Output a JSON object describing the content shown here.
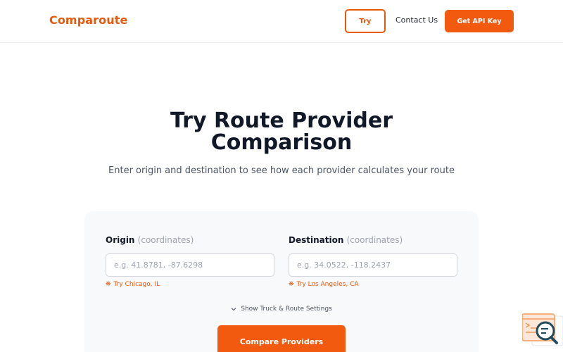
{
  "header": {
    "logo": "Comparoute",
    "try_label": "Try",
    "contact_label": "Contact Us",
    "api_label": "Get API Key"
  },
  "hero": {
    "title_line1": "Try Route Provider",
    "title_line2": "Comparison",
    "subtitle": "Enter origin and destination to see how each provider calculates your route"
  },
  "form": {
    "origin": {
      "label": "Origin",
      "hint": "(coordinates)",
      "placeholder": "e.g. 41.8781, -87.6298",
      "try_text": "Try Chicago, IL"
    },
    "destination": {
      "label": "Destination",
      "hint": "(coordinates)",
      "placeholder": "e.g. 34.0522, -118.2437",
      "try_text": "Try Los Angeles, CA"
    },
    "settings_toggle": "Show Truck & Route Settings",
    "submit_label": "Compare Providers"
  },
  "colors": {
    "accent": "#f25a0f",
    "card_bg": "#f8f9fa"
  },
  "icons": {
    "spark": "sparkle-icon",
    "chevron": "chevron-down-icon",
    "widget": "search-terminal-icon"
  }
}
